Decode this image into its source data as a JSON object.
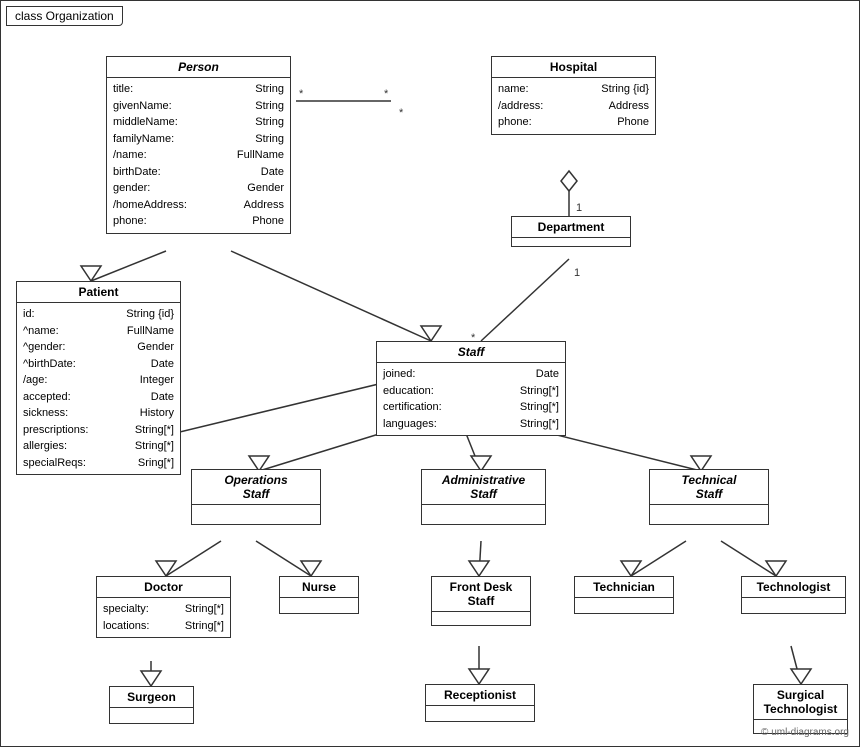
{
  "diagram": {
    "title": "class Organization",
    "copyright": "© uml-diagrams.org"
  },
  "classes": {
    "person": {
      "name": "Person",
      "italic": true,
      "attrs": [
        {
          "name": "title:",
          "type": "String"
        },
        {
          "name": "givenName:",
          "type": "String"
        },
        {
          "name": "middleName:",
          "type": "String"
        },
        {
          "name": "familyName:",
          "type": "String"
        },
        {
          "name": "/name:",
          "type": "FullName"
        },
        {
          "name": "birthDate:",
          "type": "Date"
        },
        {
          "name": "gender:",
          "type": "Gender"
        },
        {
          "name": "/homeAddress:",
          "type": "Address"
        },
        {
          "name": "phone:",
          "type": "Phone"
        }
      ]
    },
    "hospital": {
      "name": "Hospital",
      "italic": false,
      "attrs": [
        {
          "name": "name:",
          "type": "String {id}"
        },
        {
          "name": "/address:",
          "type": "Address"
        },
        {
          "name": "phone:",
          "type": "Phone"
        }
      ]
    },
    "department": {
      "name": "Department",
      "italic": false,
      "attrs": []
    },
    "staff": {
      "name": "Staff",
      "italic": true,
      "attrs": [
        {
          "name": "joined:",
          "type": "Date"
        },
        {
          "name": "education:",
          "type": "String[*]"
        },
        {
          "name": "certification:",
          "type": "String[*]"
        },
        {
          "name": "languages:",
          "type": "String[*]"
        }
      ]
    },
    "patient": {
      "name": "Patient",
      "italic": false,
      "attrs": [
        {
          "name": "id:",
          "type": "String {id}"
        },
        {
          "name": "^name:",
          "type": "FullName"
        },
        {
          "name": "^gender:",
          "type": "Gender"
        },
        {
          "name": "^birthDate:",
          "type": "Date"
        },
        {
          "name": "/age:",
          "type": "Integer"
        },
        {
          "name": "accepted:",
          "type": "Date"
        },
        {
          "name": "sickness:",
          "type": "History"
        },
        {
          "name": "prescriptions:",
          "type": "String[*]"
        },
        {
          "name": "allergies:",
          "type": "String[*]"
        },
        {
          "name": "specialReqs:",
          "type": "Sring[*]"
        }
      ]
    },
    "operations_staff": {
      "name": "Operations Staff",
      "italic": true
    },
    "administrative_staff": {
      "name": "Administrative Staff",
      "italic": true
    },
    "technical_staff": {
      "name": "Technical Staff",
      "italic": true
    },
    "doctor": {
      "name": "Doctor",
      "italic": false,
      "attrs": [
        {
          "name": "specialty:",
          "type": "String[*]"
        },
        {
          "name": "locations:",
          "type": "String[*]"
        }
      ]
    },
    "nurse": {
      "name": "Nurse",
      "italic": false,
      "attrs": []
    },
    "front_desk_staff": {
      "name": "Front Desk Staff",
      "italic": false,
      "attrs": []
    },
    "technician": {
      "name": "Technician",
      "italic": false,
      "attrs": []
    },
    "technologist": {
      "name": "Technologist",
      "italic": false,
      "attrs": []
    },
    "surgeon": {
      "name": "Surgeon",
      "italic": false,
      "attrs": []
    },
    "receptionist": {
      "name": "Receptionist",
      "italic": false,
      "attrs": []
    },
    "surgical_technologist": {
      "name": "Surgical Technologist",
      "italic": false,
      "attrs": []
    }
  }
}
